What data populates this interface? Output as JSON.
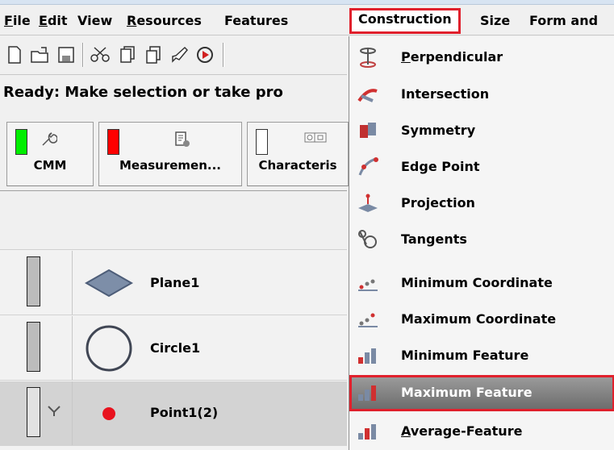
{
  "menubar": {
    "items": [
      {
        "label": "File",
        "underline": "F"
      },
      {
        "label": "Edit",
        "underline": "E"
      },
      {
        "label": "View",
        "underline": ""
      },
      {
        "label": "Resources",
        "underline": "R"
      },
      {
        "label": "Features",
        "underline": ""
      },
      {
        "label": "Construction",
        "underline": "",
        "active": true
      },
      {
        "label": "Size",
        "underline": ""
      },
      {
        "label": "Form and",
        "underline": ""
      }
    ]
  },
  "toolbar": {
    "buttons": [
      "new-file-icon",
      "open-folder-icon",
      "save-disk-icon",
      "scissors-icon",
      "copy-icon",
      "paste-icon",
      "brush-icon",
      "undo-icon"
    ]
  },
  "status": {
    "text": "Ready: Make selection or take pro"
  },
  "tabs": [
    {
      "label": "CMM",
      "swatch": "#00ee00",
      "icon": "wrench-icon"
    },
    {
      "label": "Measuremen...",
      "swatch": "#ff0000",
      "icon": "document-gear-icon"
    },
    {
      "label": "Characteris",
      "swatch": "#ffffff",
      "icon": "tolerance-frame-icon"
    }
  ],
  "features": [
    {
      "name": "Plane1",
      "shape": "plane-icon",
      "selected": false
    },
    {
      "name": "Circle1",
      "shape": "circle-icon",
      "selected": false
    },
    {
      "name": "Point1(2)",
      "shape": "point-icon",
      "selected": true
    }
  ],
  "dropdown": {
    "items": [
      {
        "label": "Perpendicular",
        "icon": "perpendicular-icon",
        "underline_index": 0
      },
      {
        "label": "Intersection",
        "icon": "intersection-icon",
        "underline_index": 0
      },
      {
        "label": "Symmetry",
        "icon": "symmetry-icon",
        "underline_index": 0
      },
      {
        "label": "Edge Point",
        "icon": "edge-point-icon",
        "underline_index": 0
      },
      {
        "label": "Projection",
        "icon": "projection-icon",
        "underline_index": 3
      },
      {
        "label": "Tangents",
        "icon": "tangents-icon",
        "underline_index": 3
      },
      {
        "label": "Minimum Coordinate",
        "icon": "minimum-coordinate-icon",
        "underline_index": 1
      },
      {
        "label": "Maximum Coordinate",
        "icon": "maximum-coordinate-icon",
        "underline_index": 2
      },
      {
        "label": "Minimum Feature",
        "icon": "minimum-feature-icon",
        "underline_index": 1
      },
      {
        "label": "Maximum Feature",
        "icon": "maximum-feature-icon",
        "underline_index": 2,
        "highlighted": true
      },
      {
        "label": "Average-Feature",
        "icon": "average-feature-icon",
        "underline_index": 0
      }
    ]
  },
  "colors": {
    "highlight_border": "#e0202c",
    "menu_bg": "#f0f0f0",
    "selected_row": "#d3d3d3"
  }
}
